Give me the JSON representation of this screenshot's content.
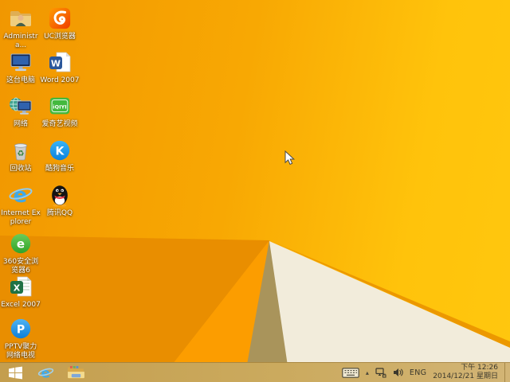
{
  "desktop_icons": [
    {
      "id": "administrator-folder",
      "label": "Administra..."
    },
    {
      "id": "uc-browser",
      "label": "UC浏览器"
    },
    {
      "id": "this-pc",
      "label": "这台电脑"
    },
    {
      "id": "word-2007",
      "label": "Word 2007",
      "glyph": "W"
    },
    {
      "id": "network",
      "label": "网络"
    },
    {
      "id": "iqiyi-video",
      "label": "爱奇艺视频",
      "glyph": "iQIYI"
    },
    {
      "id": "recycle-bin",
      "label": "回收站",
      "glyph": "♻"
    },
    {
      "id": "kugou-music",
      "label": "酷狗音乐",
      "glyph": "K"
    },
    {
      "id": "internet-explorer",
      "label": "Internet Explorer",
      "glyph": "e"
    },
    {
      "id": "tencent-qq",
      "label": "腾讯QQ"
    },
    {
      "id": "360-safe-browser",
      "label": "360安全浏览器6",
      "glyph": "e"
    },
    {
      "id": "excel-2007",
      "label": "Excel 2007",
      "glyph": "X"
    },
    {
      "id": "pptv",
      "label": "PPTV聚力 网络电视",
      "glyph": "P"
    }
  ],
  "taskbar": {
    "tray": {
      "language": "ENG",
      "time": "下午 12:26",
      "date": "2014/12/21 星期日"
    }
  },
  "wallpaper_colors": {
    "base_orange": "#F8A803",
    "bright_yellow": "#FFC30B",
    "dark_bottom_left": "#E98E00",
    "bright_triangle": "#FC9D00",
    "olive_triangle": "#A9945B",
    "cream_triangle": "#F2ECDB",
    "ridge": "#EC9800",
    "taskbar_gold": "#CBAA5E"
  }
}
